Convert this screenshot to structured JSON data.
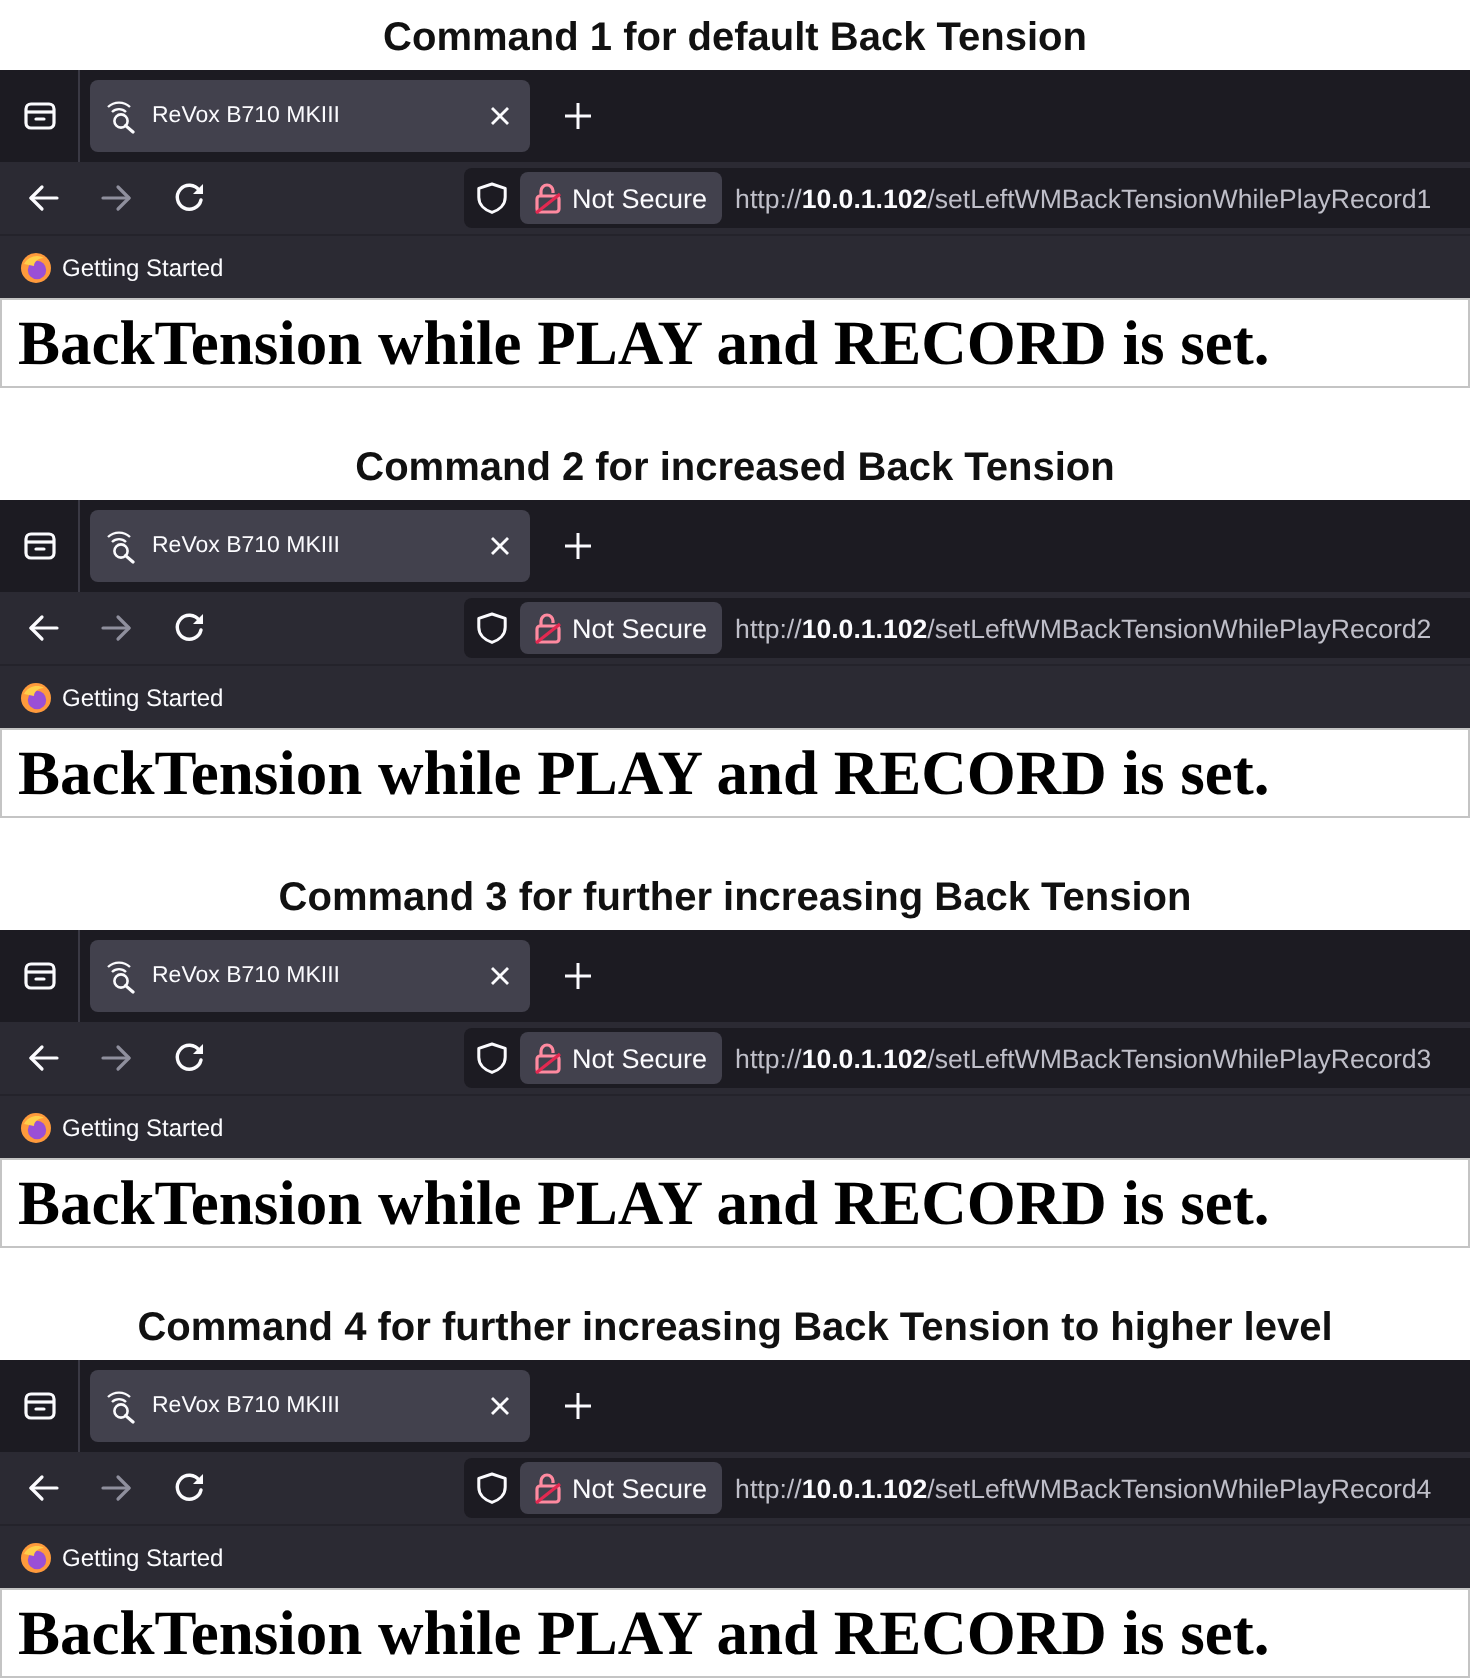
{
  "panels": [
    {
      "caption": "Command 1 for default Back Tension",
      "browser": {
        "tabs": [
          {
            "title": "ReVox B710 MKIII",
            "selected": true
          }
        ],
        "forward_disabled": true,
        "security_label": "Not Secure",
        "url": "http://**10.0.1.102**/setLeftWMBackTensionWhilePlayRecord1",
        "bookmarks": [
          "Getting Started"
        ]
      },
      "page_text": "BackTension while PLAY and RECORD is set."
    },
    {
      "caption": "Command 2 for increased Back Tension",
      "browser": {
        "tabs": [
          {
            "title": "ReVox B710 MKIII",
            "selected": true
          }
        ],
        "forward_disabled": true,
        "security_label": "Not Secure",
        "url": "http://**10.0.1.102**/setLeftWMBackTensionWhilePlayRecord2",
        "bookmarks": [
          "Getting Started"
        ]
      },
      "page_text": "BackTension while PLAY and RECORD is set."
    },
    {
      "caption": "Command 3 for further increasing Back Tension",
      "browser": {
        "tabs": [
          {
            "title": "ReVox B710 MKIII",
            "selected": true
          }
        ],
        "forward_disabled": true,
        "security_label": "Not Secure",
        "url": "http://**10.0.1.102**/setLeftWMBackTensionWhilePlayRecord3",
        "bookmarks": [
          "Getting Started"
        ]
      },
      "page_text": "BackTension while PLAY and RECORD is set."
    },
    {
      "caption": "Command 4 for further increasing Back Tension to higher level",
      "browser": {
        "tabs": [
          {
            "title": "ReVox B710 MKIII",
            "selected": true
          }
        ],
        "forward_disabled": true,
        "security_label": "Not Secure",
        "url": "http://**10.0.1.102**/setLeftWMBackTensionWhilePlayRecord4",
        "bookmarks": [
          "Getting Started"
        ]
      },
      "page_text": "BackTension while PLAY and RECORD is set."
    }
  ]
}
